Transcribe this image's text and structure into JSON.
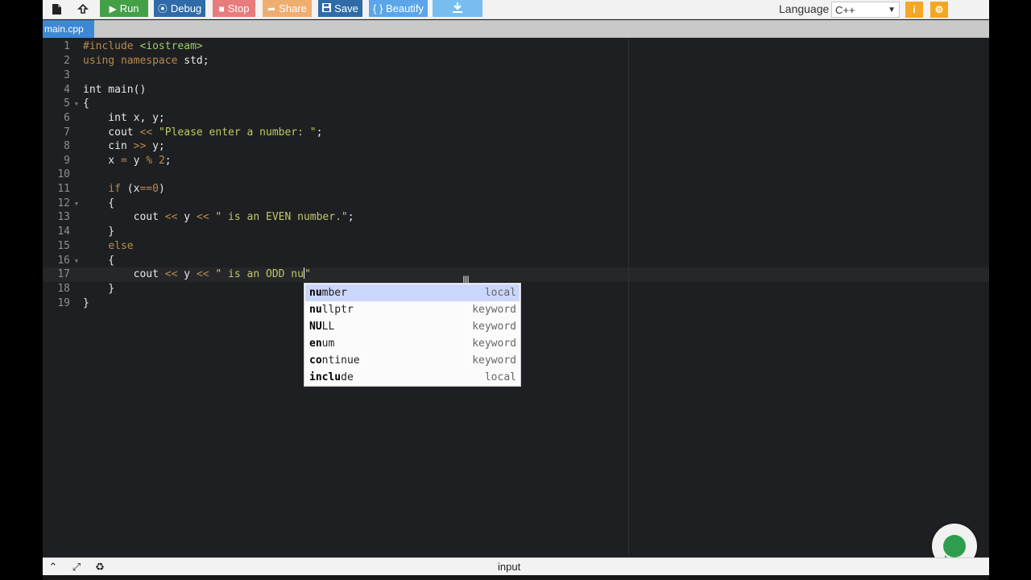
{
  "toolbar": {
    "new_file_icon": "file-icon",
    "upload_icon": "upload-icon",
    "run": "Run",
    "debug": "Debug",
    "stop": "Stop",
    "share": "Share",
    "save": "Save",
    "beautify": "{ } Beautify",
    "download_icon": "download-icon",
    "language_label": "Language",
    "language_value": "C++"
  },
  "tabs": [
    {
      "label": "main.cpp",
      "active": true
    }
  ],
  "editor": {
    "line_numbers": [
      "1",
      "2",
      "3",
      "4",
      "5",
      "6",
      "7",
      "8",
      "9",
      "10",
      "11",
      "12",
      "13",
      "14",
      "15",
      "16",
      "17",
      "18",
      "19"
    ],
    "lines": [
      "#include <iostream>",
      "using namespace std;",
      "",
      "int main()",
      "{",
      "    int x, y;",
      "    cout << \"Please enter a number: \";",
      "    cin >> y;",
      "    x = y % 2;",
      "",
      "    if (x==0)",
      "    {",
      "        cout << y << \" is an EVEN number.\";",
      "    }",
      "    else",
      "    {",
      "        cout << y << \" is an ODD nu\"",
      "    }",
      "}"
    ],
    "active_line": 17
  },
  "autocomplete": [
    {
      "prefix": "nu",
      "rest": "mber",
      "meta": "local"
    },
    {
      "prefix": "nu",
      "rest": "llptr",
      "meta": "keyword"
    },
    {
      "prefix": "NU",
      "rest": "LL",
      "meta": "keyword"
    },
    {
      "prefix": "en",
      "mid": "u",
      "rest": "m",
      "meta": "keyword"
    },
    {
      "prefix": "co",
      "mid": "ntin",
      "rest": "ue",
      "meta": "keyword"
    },
    {
      "prefix": "inclu",
      "rest": "de",
      "meta": "local"
    }
  ],
  "bottombar": {
    "label": "input"
  },
  "colors": {
    "run": "#43a047",
    "debug": "#2f6ba8",
    "stop": "#e87b7b",
    "share": "#f0ad70",
    "save": "#2f6ba8",
    "beautify": "#5aa6e8",
    "tab_active": "#3d88d4",
    "editor_bg": "#1e1f22"
  }
}
